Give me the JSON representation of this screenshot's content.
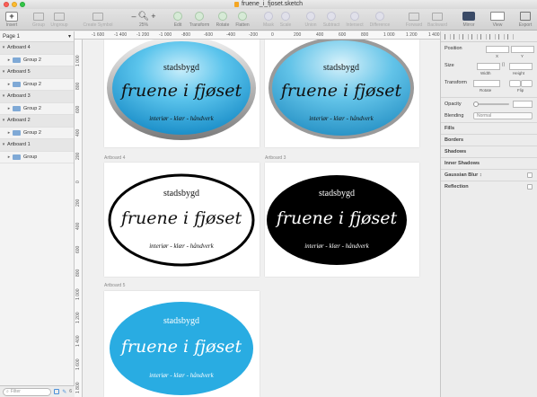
{
  "window": {
    "title": "fruene_i_fjoset.sketch"
  },
  "toolbar": {
    "insert": "Insert",
    "group": "Group",
    "ungroup": "Ungroup",
    "create_symbol": "Create Symbol",
    "zoom": "25%",
    "zoom_minus": "–",
    "zoom_plus": "+",
    "edit": "Edit",
    "transform": "Transform",
    "rotate": "Rotate",
    "flatten": "Flatten",
    "mask": "Mask",
    "scale": "Scale",
    "union": "Union",
    "subtract": "Subtract",
    "intersect": "Intersect",
    "difference": "Difference",
    "forward": "Forward",
    "backward": "Backward",
    "mirror": "Mirror",
    "view": "View",
    "export": "Export"
  },
  "layers": {
    "page": "Page 1",
    "items": [
      {
        "label": "Artboard 4",
        "type": "artboard"
      },
      {
        "label": "Group 2",
        "type": "group"
      },
      {
        "label": "Artboard 5",
        "type": "artboard"
      },
      {
        "label": "Group 2",
        "type": "group"
      },
      {
        "label": "Artboard 3",
        "type": "artboard"
      },
      {
        "label": "Group 2",
        "type": "group"
      },
      {
        "label": "Artboard 2",
        "type": "artboard"
      },
      {
        "label": "Group 2",
        "type": "group"
      },
      {
        "label": "Artboard 1",
        "type": "artboard"
      },
      {
        "label": "Group",
        "type": "group"
      }
    ],
    "filter_placeholder": "Filter",
    "count": "6"
  },
  "rulers": {
    "horizontal": [
      "-1 600",
      "-1 400",
      "-1 200",
      "-1 000",
      "-800",
      "-600",
      "-400",
      "-200",
      "0",
      "200",
      "400",
      "600",
      "800",
      "1 000",
      "1 200",
      "1 400"
    ],
    "vertical": [
      "1 000",
      "800",
      "600",
      "400",
      "200",
      "0",
      "200",
      "400",
      "600",
      "800",
      "1 000",
      "1 200",
      "1 400",
      "1 600",
      "1 800"
    ]
  },
  "artboards": {
    "a4_label": "Artboard 4",
    "a3_label": "Artboard 3",
    "a5_label": "Artboard 5"
  },
  "logo": {
    "top": "stadsbygd",
    "main": "fruene i fjøset",
    "bottom": "interiør - klær - håndverk"
  },
  "colors": {
    "accent": "#29ace2",
    "blue_glossy": "#5bc4ec",
    "black": "#000000",
    "selection": "#4a90d9"
  },
  "inspector": {
    "position": "Position",
    "x": "X",
    "y": "Y",
    "size": "Size",
    "width": "Width",
    "height": "Height",
    "transform": "Transform",
    "rotate": "Rotate",
    "flip": "Flip",
    "opacity": "Opacity",
    "blending": "Blending",
    "blending_value": "Normal",
    "fills": "Fills",
    "borders": "Borders",
    "shadows": "Shadows",
    "inner_shadows": "Inner Shadows",
    "gaussian_blur": "Gaussian Blur",
    "reflection": "Reflection"
  }
}
